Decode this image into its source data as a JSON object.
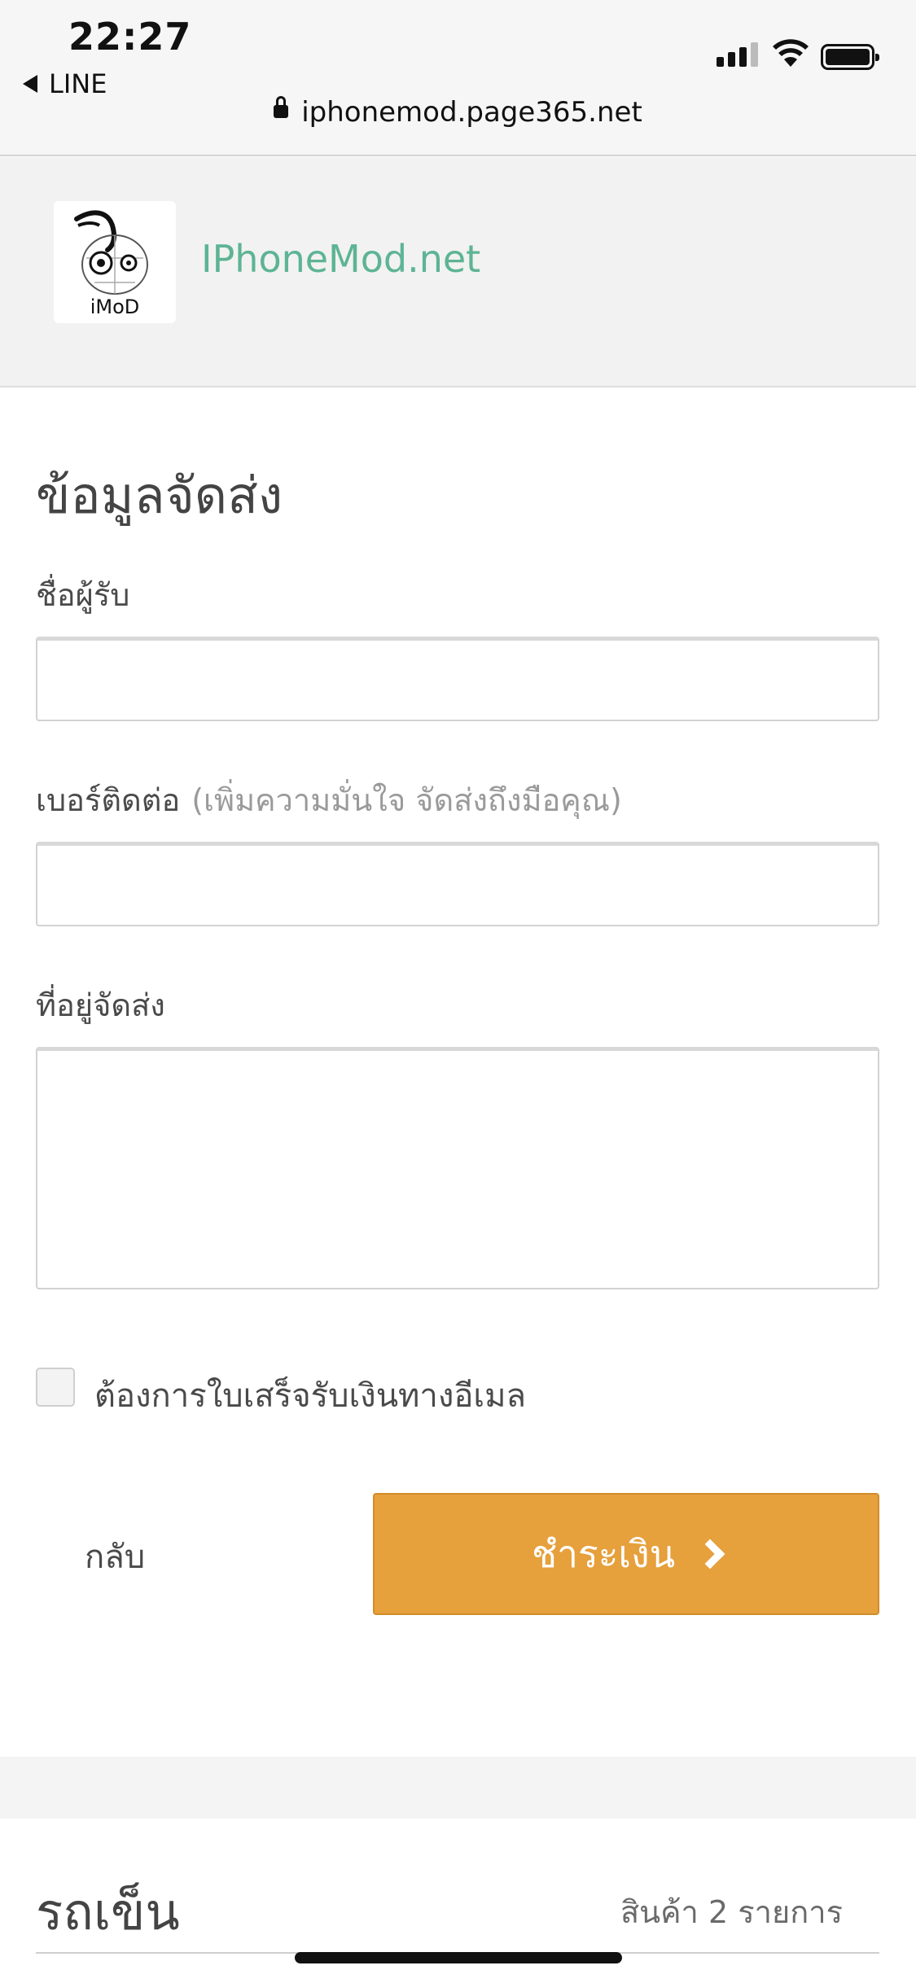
{
  "status_bar": {
    "time": "22:27",
    "back_app": "LINE",
    "url": "iphonemod.page365.net",
    "icons": [
      "signal-icon",
      "wifi-icon",
      "battery-icon",
      "lock-icon"
    ]
  },
  "header": {
    "logo_text": "iMoD",
    "site_name": "IPhoneMod.net",
    "accent_color": "#5db494"
  },
  "form": {
    "title": "ข้อมูลจัดส่ง",
    "name_label": "ชื่อผู้รับ",
    "name_value": "",
    "phone_label": "เบอร์ติดต่อ",
    "phone_hint": "(เพิ่มความมั่นใจ จัดส่งถึงมือคุณ)",
    "phone_value": "",
    "address_label": "ที่อยู่จัดส่ง",
    "address_value": "",
    "receipt_checkbox_label": "ต้องการใบเสร็จรับเงินทางอีเมล",
    "receipt_checked": false
  },
  "actions": {
    "back_label": "กลับ",
    "pay_label": "ชำระเงิน",
    "pay_color": "#e6a03c"
  },
  "cart": {
    "title": "รถเข็น",
    "count_text": "สินค้า 2 รายการ"
  }
}
